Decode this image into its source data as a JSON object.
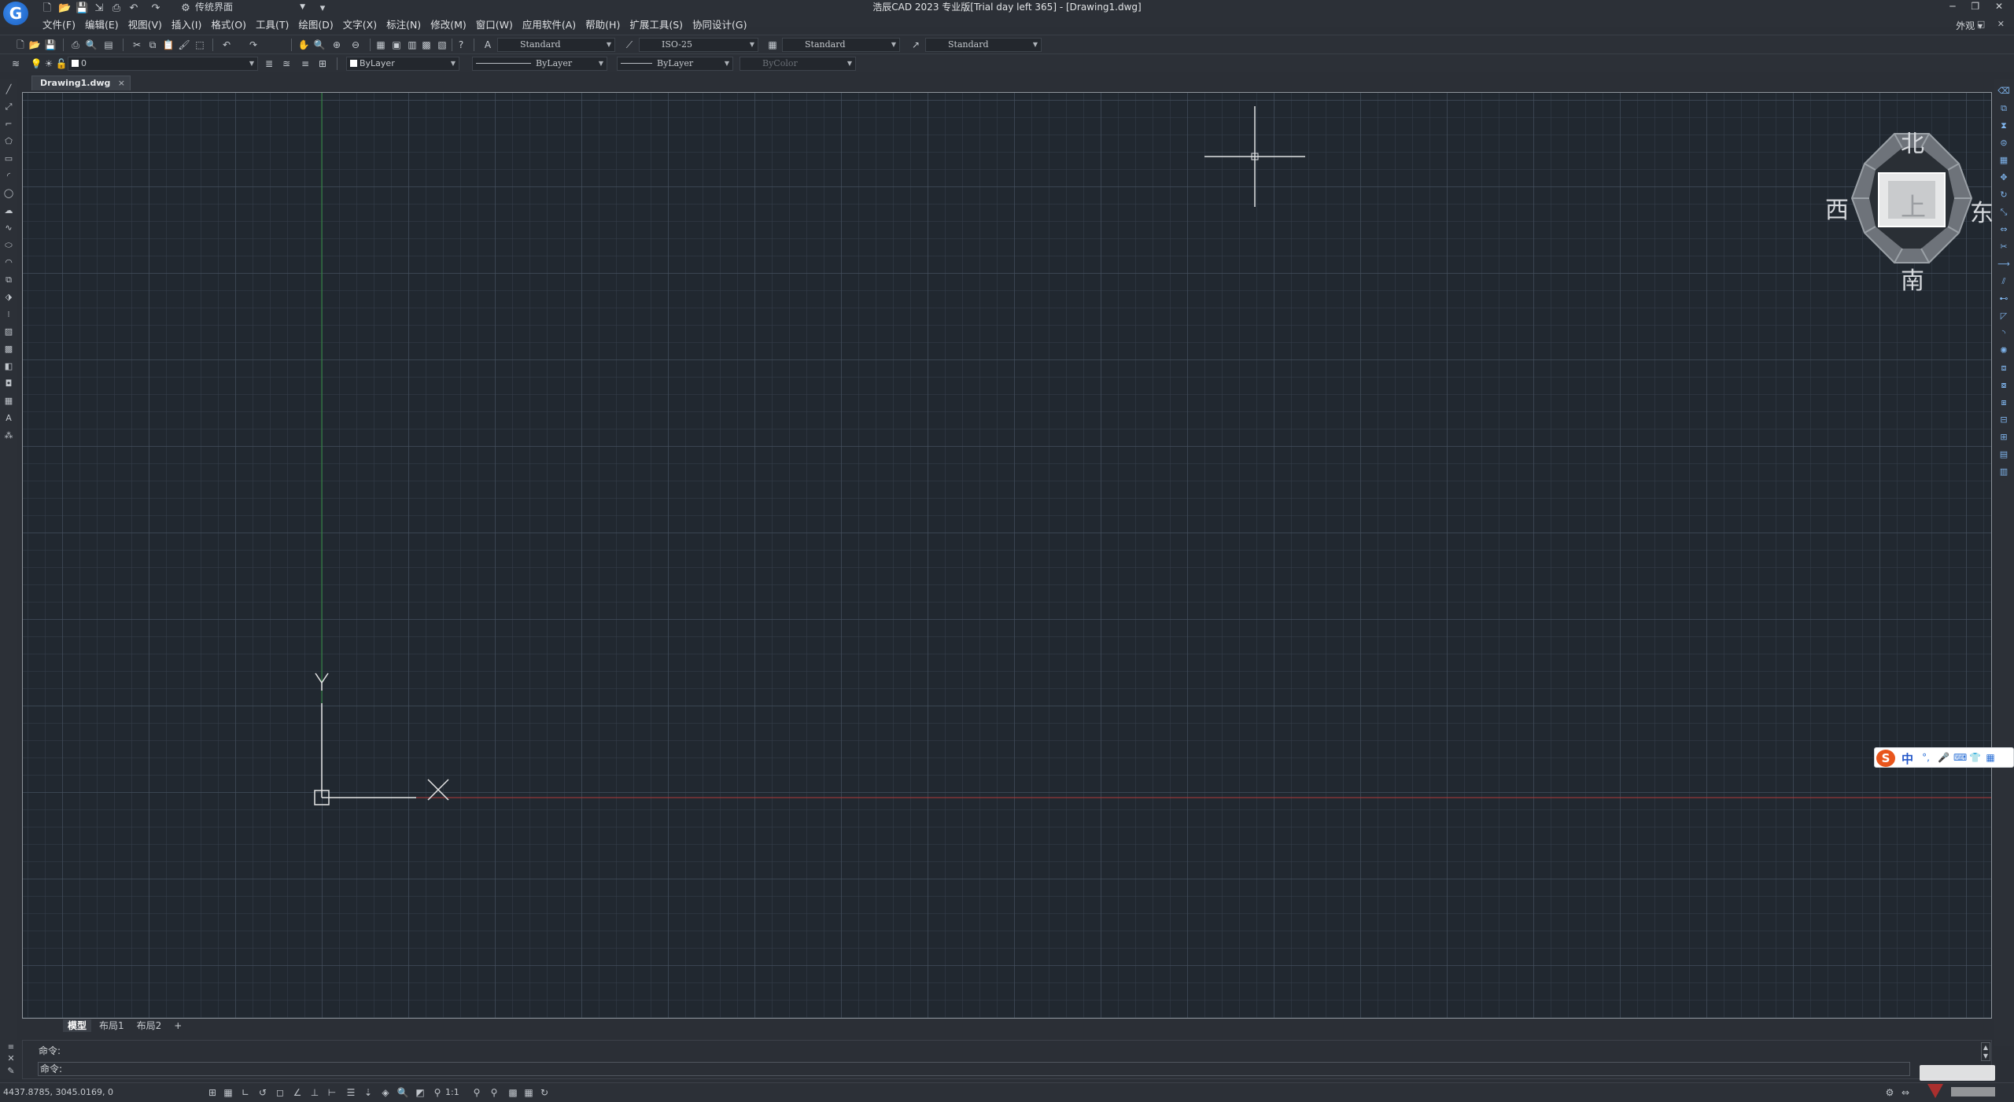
{
  "title_bar": {
    "window_title": "浩辰CAD 2023 专业版[Trial day left 365] - [Drawing1.dwg]",
    "workspace": "传统界面",
    "app_logo_letter": "G",
    "appearance_label": "外观",
    "window_controls": [
      "─",
      "❐",
      "✕"
    ],
    "doc_controls": [
      "─",
      "□",
      "✕"
    ]
  },
  "menu": {
    "items": [
      "文件(F)",
      "编辑(E)",
      "视图(V)",
      "插入(I)",
      "格式(O)",
      "工具(T)",
      "绘图(D)",
      "文字(X)",
      "标注(N)",
      "修改(M)",
      "窗口(W)",
      "应用软件(A)",
      "帮助(H)",
      "扩展工具(S)",
      "协同设计(G)"
    ]
  },
  "toolbar1": {
    "text_style": "Standard",
    "dim_style": "ISO-25",
    "table_style": "Standard",
    "multileader_style": "Standard"
  },
  "toolbar2": {
    "layer": "0",
    "color": "ByLayer",
    "linetype": "ByLayer",
    "lineweight": "ByLayer",
    "plot_style": "ByColor"
  },
  "document_tab": {
    "name": "Drawing1.dwg",
    "close": "×"
  },
  "canvas": {
    "ucs_y_label": "Y",
    "ucs_x_label": "X",
    "colors": {
      "background": "#212830",
      "x_axis": "#b23a3a",
      "y_axis": "#2f8a3c",
      "ucs": "#e6e6e6"
    }
  },
  "viewcube": {
    "north": "北",
    "south": "南",
    "east": "东",
    "west": "西",
    "top": "上"
  },
  "layout_tabs": {
    "items": [
      "模型",
      "布局1",
      "布局2"
    ],
    "add": "+",
    "active_index": 0
  },
  "command": {
    "history_line": "命令:",
    "prompt": "命令:"
  },
  "statusbar": {
    "coordinates": "4437.8785, 3045.0169, 0",
    "scale": "1:1"
  },
  "ime": {
    "logo": "S",
    "mode": "中"
  }
}
